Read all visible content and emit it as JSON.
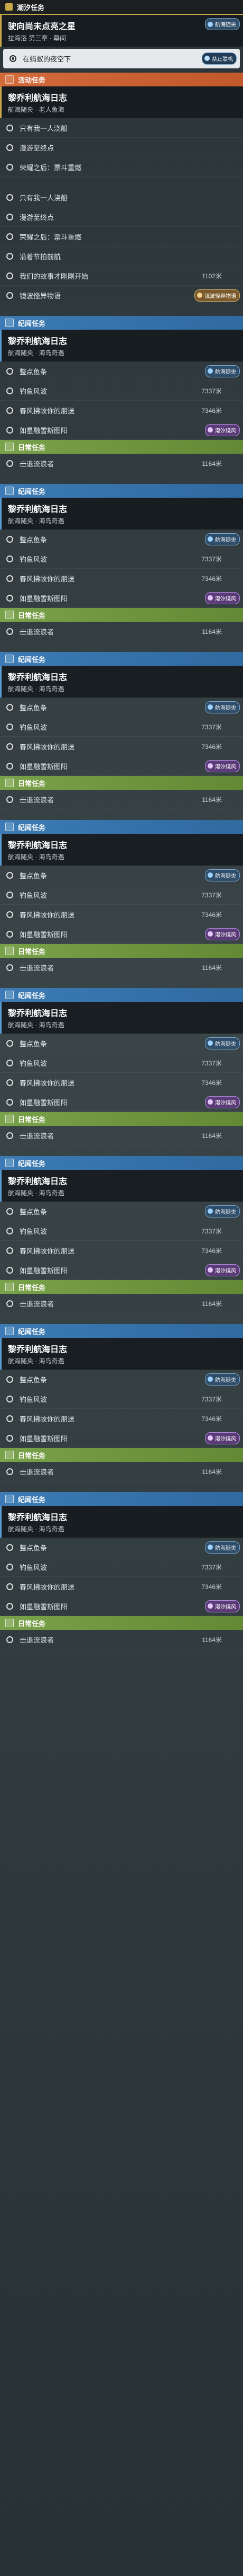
{
  "tide": {
    "header": "潮汐任务",
    "title": "驶向尚未点亮之星",
    "subtitle": "拉海洛 第三章 · 幕间",
    "current": "在蚂蚁的夜空下",
    "offline_badge": "禁止联机"
  },
  "event": {
    "header": "活动任务",
    "title": "黎乔利航海日志",
    "subtitle": "航海随央 · 老人鱼海",
    "items": [
      "只有我一人浇船",
      "漫游至终点",
      "荣耀之后：票斗重燃"
    ],
    "nav_badge": "航海随央"
  },
  "event2": {
    "items": [
      "只有我一人浇船",
      "漫游至终点",
      "荣耀之后：票斗重燃",
      "沿着节拍前航",
      "我们的故事才刚刚开始",
      "镜波怪异物语"
    ],
    "distance": "1102米",
    "tip_badge": "镜波怪异物语"
  },
  "ji_header": "纪闻任务",
  "ji_title": "黎乔利航海日志",
  "ji_subtitle": "航海随央 · 海岛奇遇",
  "ji_first_item": "镜波怪异物语",
  "ji_items": [
    "整点鱼条",
    "钓鱼风波",
    "春风拂故你的朋送",
    "如星融雪斯图阳"
  ],
  "dist1": "7337米",
  "dist2": "7346米",
  "nav_badge": "航海随央",
  "tide_badge": "潮汐绕风",
  "daily_header": "日常任务",
  "daily_item": "击退流浪者",
  "daily_dist": "1164米"
}
